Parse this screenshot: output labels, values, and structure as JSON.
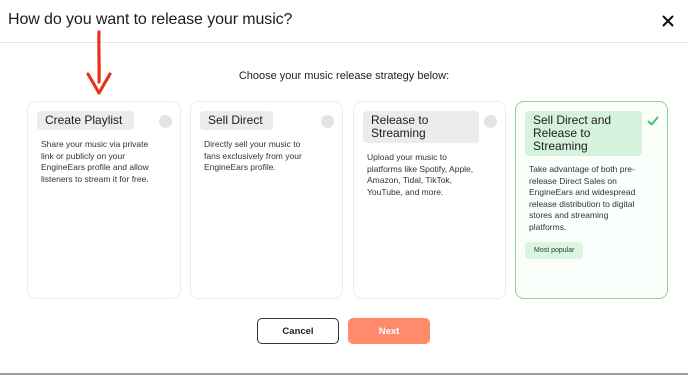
{
  "modal": {
    "title": "How do you want to release your music?",
    "close_icon": "close-icon"
  },
  "subtitle": "Choose your music release strategy below:",
  "options": [
    {
      "title_lines": [
        "Create Playlist"
      ],
      "desc_lines": [
        "Share your music via private",
        "link or publicly on your",
        "EngineEars profile and allow",
        "listeners to stream it for free."
      ],
      "selected": false
    },
    {
      "title_lines": [
        "Sell Direct"
      ],
      "desc_lines": [
        "Directly sell your music to",
        "fans exclusively from your",
        "EngineEars profile."
      ],
      "selected": false
    },
    {
      "title_lines": [
        "Release to",
        "Streaming"
      ],
      "desc_lines": [
        "Upload your music to",
        "platforms like Spotify, Apple,",
        "Amazon, Tidal, TikTok,",
        "YouTube, and more."
      ],
      "selected": false
    },
    {
      "title_lines": [
        "Sell Direct and",
        "Release to",
        "Streaming"
      ],
      "desc_lines": [
        "Take advantage of both pre-",
        "release Direct Sales on",
        "EngineEars and widespread",
        "release distribution to digital",
        "stores and streaming",
        "platforms."
      ],
      "selected": true,
      "badge": "Most popular"
    }
  ],
  "buttons": {
    "cancel": "Cancel",
    "next": "Next"
  },
  "colors": {
    "accent_next": "#ff8b6c",
    "selected_border": "#8fd39b",
    "selected_fill": "#d5f3dc",
    "check": "#43c461",
    "annotation_arrow": "#e8321e"
  },
  "annotation": {
    "icon": "arrow-down-icon"
  }
}
